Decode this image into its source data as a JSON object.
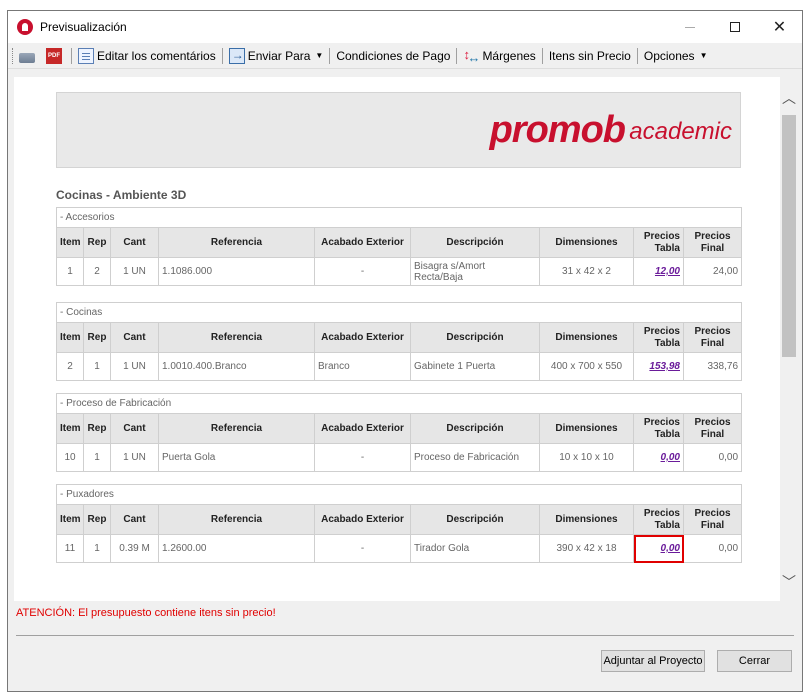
{
  "window": {
    "title": "Previsualización"
  },
  "toolbar": {
    "editar": "Editar los comentários",
    "enviar": "Enviar Para",
    "condiciones": "Condiciones de Pago",
    "margenes": "Márgenes",
    "itens_sin_precio": "Itens sin Precio",
    "opciones": "Opciones"
  },
  "report": {
    "logo_main": "promob",
    "logo_sub": "academic",
    "heading": "Cocinas - Ambiente 3D",
    "headers": {
      "item": "Item",
      "rep": "Rep",
      "cant": "Cant",
      "referencia": "Referencia",
      "acabado": "Acabado Exterior",
      "descripcion": "Descripción",
      "dimensiones": "Dimensiones",
      "precios_tabla": "Precios Tabla",
      "precios_final": "Precios Final"
    },
    "sections": [
      {
        "title": "- Accesorios",
        "row": {
          "item": "1",
          "rep": "2",
          "cant": "1 UN",
          "referencia": "1.1086.000",
          "acabado": "-",
          "descripcion": "Bisagra s/Amort Recta/Baja",
          "dimensiones": "31 x 42 x 2",
          "precio_tabla": "12,00",
          "precio_final": "24,00"
        }
      },
      {
        "title": "- Cocinas",
        "row": {
          "item": "2",
          "rep": "1",
          "cant": "1 UN",
          "referencia": "1.0010.400.Branco",
          "acabado": "Branco",
          "descripcion": "Gabinete 1 Puerta",
          "dimensiones": "400 x 700 x 550",
          "precio_tabla": "153,98",
          "precio_final": "338,76"
        }
      },
      {
        "title": "- Proceso de Fabricación",
        "row": {
          "item": "10",
          "rep": "1",
          "cant": "1 UN",
          "referencia": "Puerta Gola",
          "acabado": "-",
          "descripcion": "Proceso de Fabricación",
          "dimensiones": "10 x 10 x 10",
          "precio_tabla": "0,00",
          "precio_final": "0,00"
        }
      },
      {
        "title": "- Puxadores",
        "row": {
          "item": "11",
          "rep": "1",
          "cant": "0.39 M",
          "referencia": "1.2600.00",
          "acabado": "-",
          "descripcion": "Tirador Gola",
          "dimensiones": "390 x 42 x 18",
          "precio_tabla": "0,00",
          "precio_final": "0,00"
        }
      }
    ]
  },
  "footer": {
    "warning": "ATENCIÓN: El presupuesto contiene itens sin precio!",
    "adjuntar": "Adjuntar al Proyecto",
    "cerrar": "Cerrar"
  }
}
